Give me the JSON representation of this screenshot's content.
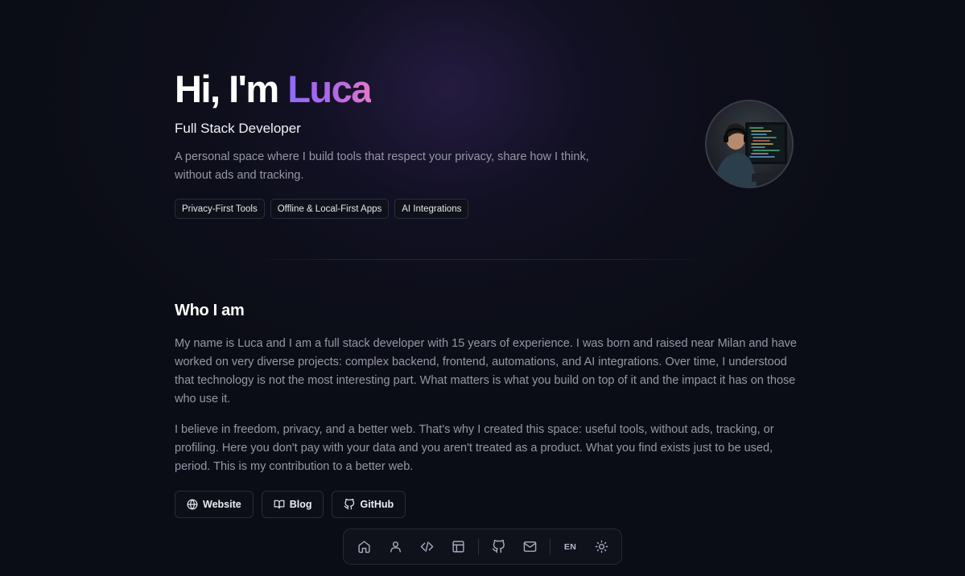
{
  "hero": {
    "greeting": "Hi, I'm",
    "name": "Luca",
    "subtitle": "Full Stack Developer",
    "description": "A personal space where I build tools that respect your privacy, share how I think, without ads and tracking.",
    "tags": [
      "Privacy-First Tools",
      "Offline & Local-First Apps",
      "AI Integrations"
    ],
    "avatar_icon": "developer-at-computer-photo"
  },
  "about": {
    "title": "Who I am",
    "paragraphs": [
      "My name is Luca and I am a full stack developer with 15 years of experience. I was born and raised near Milan and have worked on very diverse projects: complex backend, frontend, automations, and AI integrations. Over time, I understood that technology is not the most interesting part. What matters is what you build on top of it and the impact it has on those who use it.",
      "I believe in freedom, privacy, and a better web. That's why I created this space: useful tools, without ads, tracking, or profiling. Here you don't pay with your data and you aren't treated as a product. What you find exists just to be used, period. This is my contribution to a better web."
    ],
    "links": [
      {
        "label": "Website",
        "icon": "globe-icon"
      },
      {
        "label": "Blog",
        "icon": "book-icon"
      },
      {
        "label": "GitHub",
        "icon": "github-icon"
      }
    ]
  },
  "dock": {
    "items": [
      "home-icon",
      "user-icon",
      "code-icon",
      "layout-icon",
      "github-icon",
      "mail-icon",
      "language",
      "sun-icon"
    ],
    "language_label": "EN"
  },
  "colors": {
    "background": "#0b0d16",
    "accent_start": "#8b6cf6",
    "accent_end": "#e07ac8",
    "muted_text": "#9597a6"
  }
}
